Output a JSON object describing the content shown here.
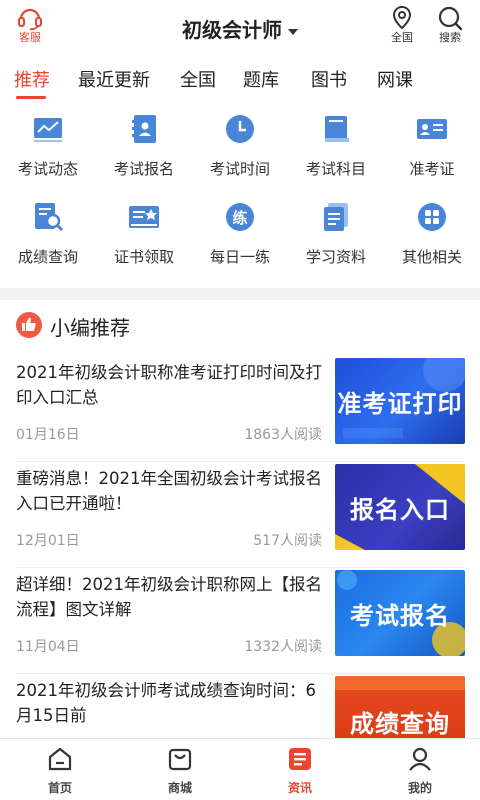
{
  "header": {
    "service_label": "客服",
    "title": "初级会计师",
    "region_label": "全国",
    "search_label": "搜索"
  },
  "tabs": [
    "推荐",
    "最近更新",
    "全国",
    "题库",
    "图书",
    "网课"
  ],
  "grid": [
    {
      "label": "考试动态",
      "icon": "trend-chart-icon"
    },
    {
      "label": "考试报名",
      "icon": "contact-book-icon"
    },
    {
      "label": "考试时间",
      "icon": "clock-icon"
    },
    {
      "label": "考试科目",
      "icon": "book-icon"
    },
    {
      "label": "准考证",
      "icon": "id-card-icon"
    },
    {
      "label": "成绩查询",
      "icon": "doc-search-icon"
    },
    {
      "label": "证书领取",
      "icon": "certificate-icon"
    },
    {
      "label": "每日一练",
      "icon": "practice-icon"
    },
    {
      "label": "学习资料",
      "icon": "documents-icon"
    },
    {
      "label": "其他相关",
      "icon": "apps-icon"
    }
  ],
  "section": {
    "title": "小编推荐"
  },
  "articles": [
    {
      "title": "2021年初级会计职称准考证打印时间及打印入口汇总",
      "date": "01月16日",
      "reads": "1863人阅读",
      "thumb": "准考证打印"
    },
    {
      "title": "重磅消息！2021年全国初级会计考试报名入口已开通啦！",
      "date": "12月01日",
      "reads": "517人阅读",
      "thumb": "报名入口"
    },
    {
      "title": "超详细！2021年初级会计职称网上【报名流程】图文详解",
      "date": "11月04日",
      "reads": "1332人阅读",
      "thumb": "考试报名"
    },
    {
      "title": "2021年初级会计师考试成绩查询时间：6月15日前",
      "date": "",
      "reads": "",
      "thumb": "成绩查询"
    }
  ],
  "bottom_nav": [
    "首页",
    "商城",
    "资讯",
    "我的"
  ],
  "colors": {
    "accent": "#e8462e",
    "icon_blue": "#4a86d8"
  }
}
